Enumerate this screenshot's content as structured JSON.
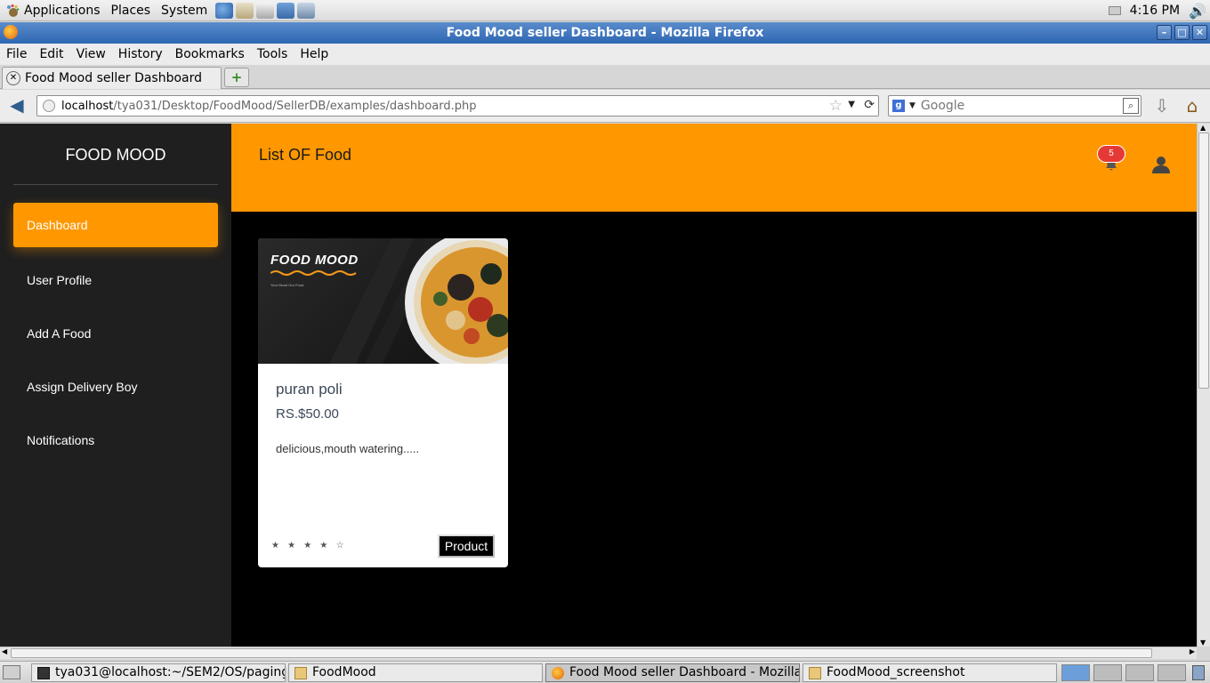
{
  "top_panel": {
    "menus": [
      "Applications",
      "Places",
      "System"
    ],
    "clock": "4:16 PM"
  },
  "window": {
    "title": "Food Mood seller Dashboard - Mozilla Firefox",
    "controls": [
      "minimize",
      "maximize",
      "close"
    ]
  },
  "menubar": [
    "File",
    "Edit",
    "View",
    "History",
    "Bookmarks",
    "Tools",
    "Help"
  ],
  "tab": {
    "label": "Food Mood seller Dashboard"
  },
  "navbar": {
    "url_host": "localhost",
    "url_path": "/tya031/Desktop/FoodMood/SellerDB/examples/dashboard.php",
    "search_placeholder": "Google"
  },
  "sidebar": {
    "brand": "FOOD MOOD",
    "items": [
      {
        "label": "Dashboard",
        "active": true
      },
      {
        "label": "User Profile",
        "active": false
      },
      {
        "label": "Add A Food",
        "active": false
      },
      {
        "label": "Assign Delivery Boy",
        "active": false
      },
      {
        "label": "Notifications",
        "active": false
      }
    ]
  },
  "header": {
    "title": "List OF Food",
    "notification_count": "5"
  },
  "food_card": {
    "image_brand": "FOOD MOOD",
    "image_tagline": "Your Mood Our Food",
    "name": "puran poli",
    "price": "RS.$50.00",
    "description": "delicious,mouth watering.....",
    "stars": "★ ★ ★ ★ ☆",
    "rating": 4,
    "rating_max": 5,
    "button_label": "Product"
  },
  "taskbar": {
    "tasks": [
      {
        "label": "tya031@localhost:~/SEM2/OS/paging",
        "active": false
      },
      {
        "label": "FoodMood",
        "active": false
      },
      {
        "label": "Food Mood seller Dashboard - Mozilla...",
        "active": true
      },
      {
        "label": "FoodMood_screenshot",
        "active": false
      }
    ]
  },
  "colors": {
    "accent": "#ff9800",
    "sidebar_bg": "#1f1f1f",
    "content_bg": "#000000",
    "badge": "#e53935"
  }
}
